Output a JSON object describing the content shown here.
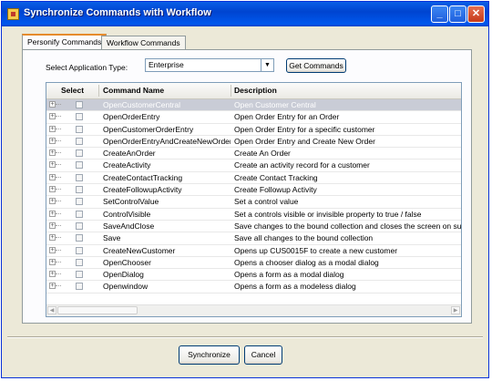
{
  "window": {
    "title": "Synchronize Commands with Workflow"
  },
  "tabs": [
    {
      "label": "Personify Commands",
      "active": true
    },
    {
      "label": "Workflow Commands",
      "active": false
    }
  ],
  "form": {
    "app_type_label": "Select Application Type:",
    "app_type_value": "Enterprise",
    "get_commands_label": "Get Commands"
  },
  "grid": {
    "columns": [
      "Select",
      "Command Name",
      "Description"
    ],
    "rows": [
      {
        "name": "OpenCustomerCentral",
        "desc": "Open Customer Central",
        "selected": true
      },
      {
        "name": "OpenOrderEntry",
        "desc": "Open Order Entry for an Order"
      },
      {
        "name": "OpenCustomerOrderEntry",
        "desc": "Open Order Entry for a specific customer"
      },
      {
        "name": "OpenOrderEntryAndCreateNewOrder",
        "desc": "Open Order Entry and Create New Order"
      },
      {
        "name": "CreateAnOrder",
        "desc": "Create An Order"
      },
      {
        "name": "CreateActivity",
        "desc": "Create an activity record for a customer"
      },
      {
        "name": "CreateContactTracking",
        "desc": "Create Contact Tracking"
      },
      {
        "name": "CreateFollowupActivity",
        "desc": "Create Followup Activity"
      },
      {
        "name": "SetControlValue",
        "desc": "Set a control value"
      },
      {
        "name": "ControlVisible",
        "desc": "Set a controls visible or invisible property to true / false"
      },
      {
        "name": "SaveAndClose",
        "desc": "Save changes to the bound collection and closes the screen on succ"
      },
      {
        "name": "Save",
        "desc": "Save all changes to the bound collection"
      },
      {
        "name": "CreateNewCustomer",
        "desc": "Opens up CUS0015F to create a new customer"
      },
      {
        "name": "OpenChooser",
        "desc": "Opens a chooser dialog as a modal dialog"
      },
      {
        "name": "OpenDialog",
        "desc": "Opens a form as a modal dialog"
      },
      {
        "name": "Openwindow",
        "desc": "Opens a form as a modeless dialog"
      }
    ]
  },
  "buttons": {
    "synchronize": "Synchronize",
    "cancel": "Cancel"
  }
}
